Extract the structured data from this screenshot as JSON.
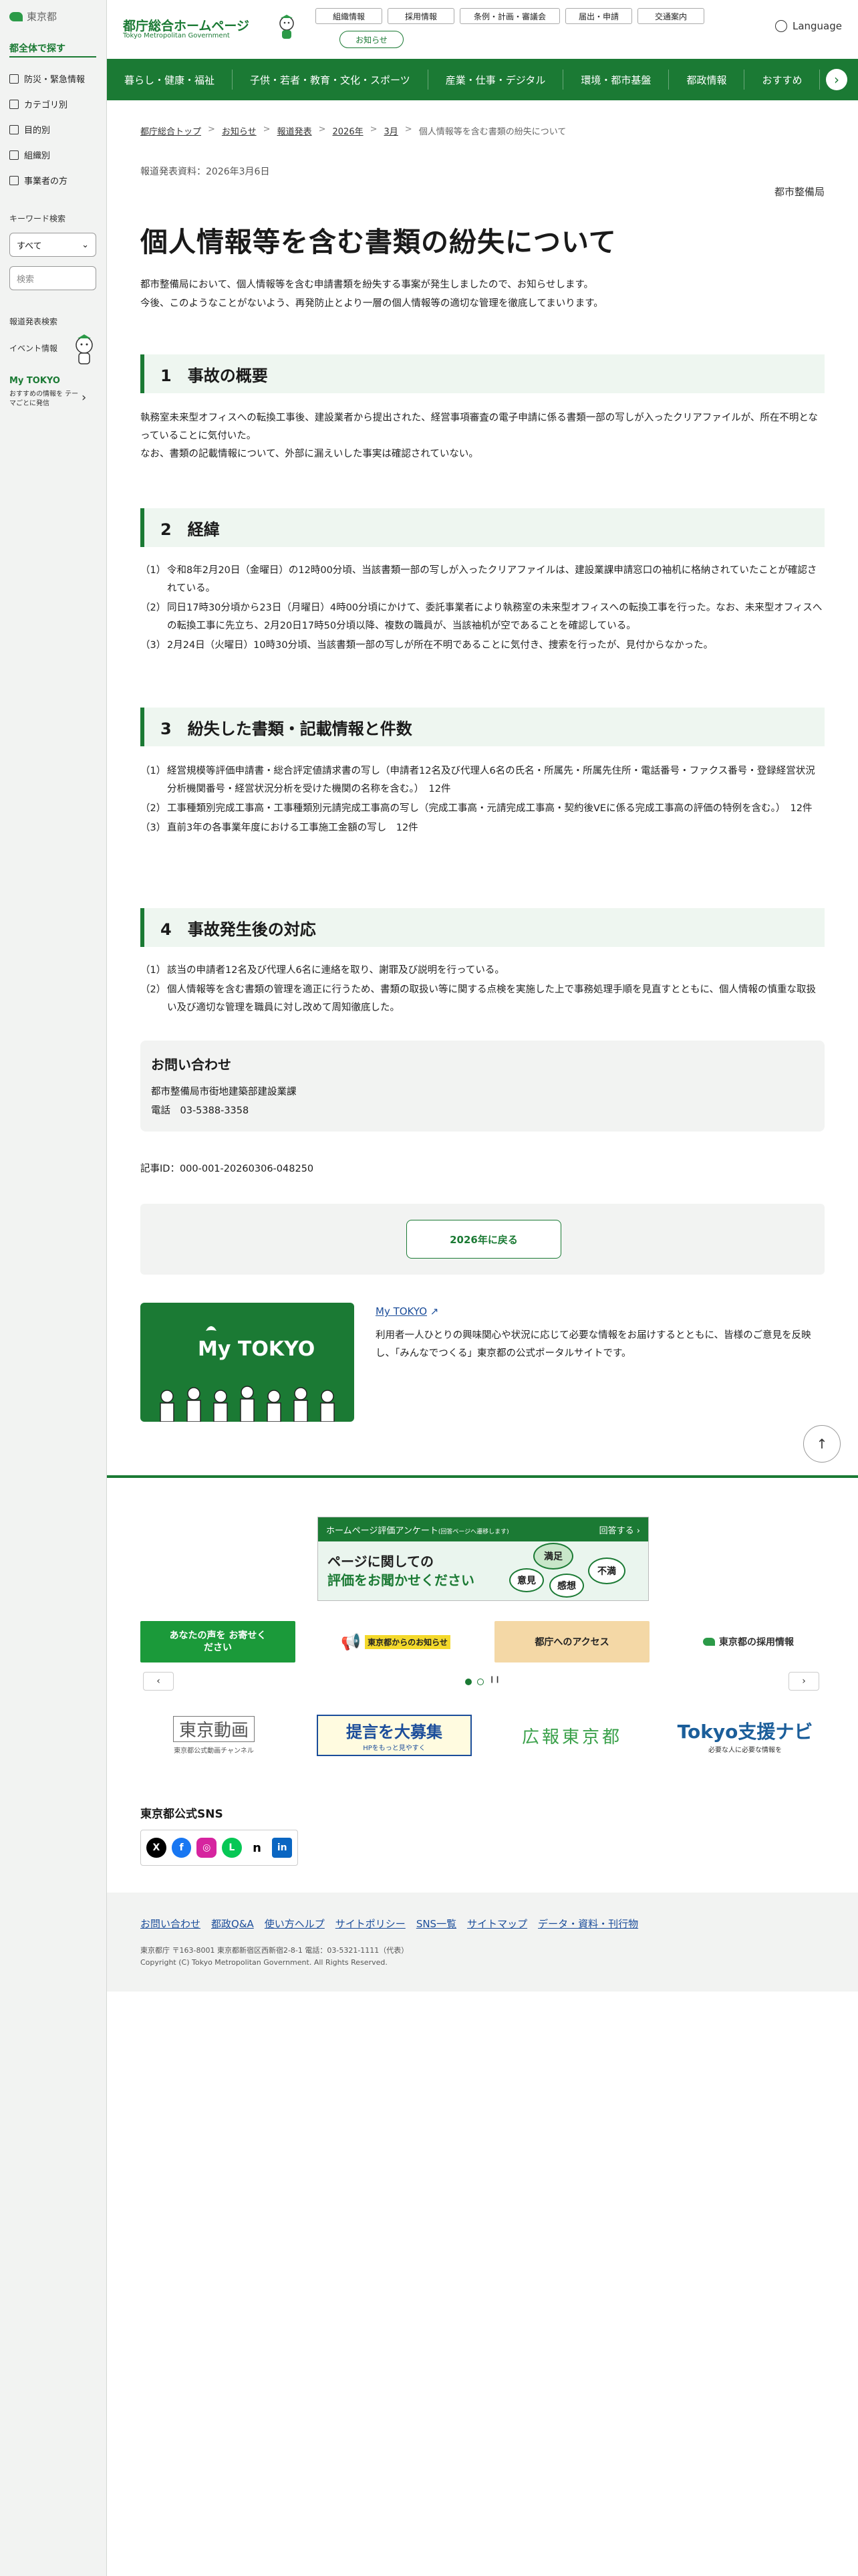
{
  "sidebar": {
    "logo_text": "東京都",
    "head": "都全体で探す",
    "items": [
      "防災・緊急情報",
      "カテゴリ別",
      "目的別",
      "組織別",
      "事業者の方"
    ],
    "keyword_label": "キーワード検索",
    "select_value": "すべて",
    "search_placeholder": "検索",
    "press_label": "報道発表検索",
    "event_label": "イベント情報",
    "mytokyo_title": "My TOKYO",
    "mytokyo_sub": "おすすめの情報を テーマごとに発信"
  },
  "header": {
    "title": "都庁総合ホームページ",
    "subtitle": "Tokyo Metropolitan Government",
    "buttons": [
      "組織情報",
      "採用情報",
      "条例・計画・審議会",
      "届出・申請",
      "交通案内"
    ],
    "notice": "お知らせ",
    "language": "Language"
  },
  "nav": {
    "items": [
      "暮らし・健康・福祉",
      "子供・若者・教育・文化・スポーツ",
      "産業・仕事・デジタル",
      "環境・都市基盤",
      "都政情報",
      "おすすめ"
    ],
    "next_label": "›"
  },
  "breadcrumb": [
    "都庁総合トップ",
    "お知らせ",
    "報道発表",
    "2026年",
    "3月",
    "個人情報等を含む書類の紛失について"
  ],
  "release": "報道発表資料：2026年3月6日",
  "dept": "都市整備局",
  "title": "個人情報等を含む書類の紛失について",
  "intro": [
    "都市整備局において、個人情報等を含む申請書類を紛失する事案が発生しましたので、お知らせします。",
    "今後、このようなことがないよう、再発防止とより一層の個人情報等の適切な管理を徹底してまいります。"
  ],
  "sections": [
    {
      "heading": "1　事故の概要",
      "lines": [
        "執務室未来型オフィスへの転換工事後、建設業者から提出された、経営事項審査の電子申請に係る書類一部の写しが入ったクリアファイルが、所在不明となっていることに気付いた。",
        "なお、書類の記載情報について、外部に漏えいした事実は確認されていない。"
      ]
    },
    {
      "heading": "2　経緯",
      "items": [
        {
          "n": "（1）",
          "t": "令和8年2月20日（金曜日）の12時00分頃、当該書類一部の写しが入ったクリアファイルは、建設業課申請窓口の袖机に格納されていたことが確認されている。"
        },
        {
          "n": "（2）",
          "t": "同日17時30分頃から23日（月曜日）4時00分頃にかけて、委託事業者により執務室の未来型オフィスへの転換工事を行った。なお、未来型オフィスへの転換工事に先立ち、2月20日17時50分頃以降、複数の職員が、当該袖机が空であることを確認している。"
        },
        {
          "n": "（3）",
          "t": "2月24日（火曜日）10時30分頃、当該書類一部の写しが所在不明であることに気付き、捜索を行ったが、見付からなかった。"
        }
      ]
    },
    {
      "heading": "3　紛失した書類・記載情報と件数",
      "items": [
        {
          "n": "（1）",
          "t": "経営規模等評価申請書・総合評定値請求書の写し（申請者12名及び代理人6名の氏名・所属先・所属先住所・電話番号・ファクス番号・登録経営状況分析機関番号・経営状況分析を受けた機関の名称を含む。）　12件"
        },
        {
          "n": "（2）",
          "t": "工事種類別完成工事高・工事種類別元請完成工事高の写し（完成工事高・元請完成工事高・契約後VEに係る完成工事高の評価の特例を含む。）　12件"
        },
        {
          "n": "（3）",
          "t": "直前3年の各事業年度における工事施工金額の写し　12件"
        }
      ]
    },
    {
      "heading": "4　事故発生後の対応",
      "items": [
        {
          "n": "（1）",
          "t": "該当の申請者12名及び代理人6名に連絡を取り、謝罪及び説明を行っている。"
        },
        {
          "n": "（2）",
          "t": "個人情報等を含む書類の管理を適正に行うため、書類の取扱い等に関する点検を実施した上で事務処理手順を見直すとともに、個人情報の慎重な取扱い及び適切な管理を職員に対し改めて周知徹底した。"
        }
      ]
    }
  ],
  "contact": {
    "title": "お問い合わせ",
    "dept": "都市整備局市街地建築部建設業課",
    "phone": "電話　03-5388-3358"
  },
  "article_id": "記事ID：000-001-20260306-048250",
  "back": "2026年に戻る",
  "mytokyo": {
    "logo": "My TOKYO",
    "link": "My TOKYO",
    "desc": "利用者一人ひとりの興味関心や状況に応じて必要な情報をお届けするとともに、皆様のご意見を反映し、「みんなでつくる」東京都の公式ポータルサイトです。"
  },
  "pagetop": "↑",
  "survey": {
    "bar": "ホームページ評価アンケート",
    "bar_small": "(回答ページへ遷移します)",
    "bar_right": "回答する ›",
    "main1": "ページに関しての",
    "main2": "評価をお聞かせください",
    "b1": "満足",
    "b2": "意見",
    "b3": "感想",
    "b4": "不満"
  },
  "banners": {
    "voice": "あなたの声を お寄せください",
    "notice": "東京都からのお知らせ",
    "access": "都庁へのアクセス",
    "recruit": "東京都の採用情報"
  },
  "pager": {
    "prev": "‹",
    "next": "›",
    "pause": "❙❙"
  },
  "logos": {
    "video": "東京動画",
    "video_sub": "東京都公式動画チャンネル",
    "teigen": "提言を大募集",
    "teigen_sub": "HPをもっと見やすく",
    "kouhou": "広報東京都",
    "navi": "Tokyo支援ナビ",
    "navi_sub": "必要な人に必要な情報を"
  },
  "sns": {
    "title": "東京都公式SNS",
    "icons": [
      "X",
      "f",
      "◎",
      "L",
      "n",
      "in"
    ]
  },
  "footer": {
    "links": [
      "お問い合わせ",
      "都政Q&A",
      "使い方ヘルプ",
      "サイトポリシー",
      "SNS一覧",
      "サイトマップ",
      "データ・資料・刊行物"
    ],
    "address": "東京都庁 〒163-8001 東京都新宿区西新宿2-8-1 電話：03-5321-1111（代表）",
    "copyright": "Copyright (C) Tokyo Metropolitan Government. All Rights Reserved."
  },
  "colors": {
    "brand": "#1b7a34",
    "link": "#1b4d9a",
    "section_bg": "#eef6f0"
  }
}
